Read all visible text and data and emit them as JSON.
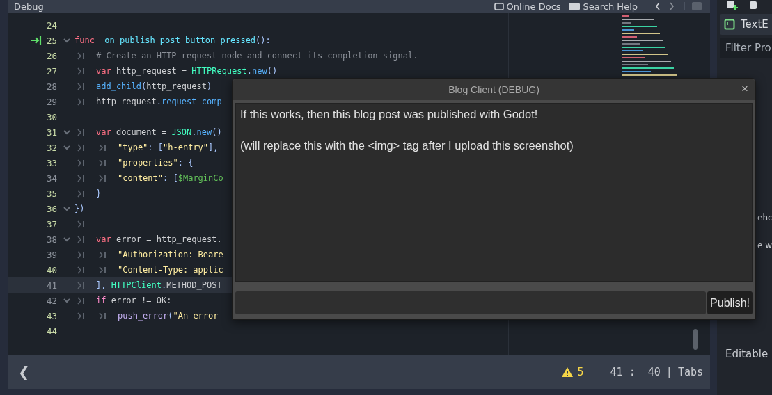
{
  "top_bar": {
    "menu_item": "Debug",
    "links": [
      {
        "kind": "docs",
        "label": "Online Docs"
      },
      {
        "kind": "help",
        "label": "Search Help"
      }
    ]
  },
  "editor": {
    "lines": [
      {
        "number": "24",
        "modified": true,
        "foldable": false,
        "executing": false,
        "current": false
      },
      {
        "number": "25",
        "modified": true,
        "foldable": true,
        "executing": true,
        "current": false,
        "tokens": [
          {
            "kind": "keyword",
            "text": "func"
          },
          {
            "kind": "funcname",
            "text": " _on_publish_post_button_pressed"
          },
          {
            "kind": "symbol",
            "text": "():"
          }
        ]
      },
      {
        "number": "26",
        "modified": true,
        "foldable": false,
        "executing": false,
        "current": false,
        "indent": [
          {
            "kind": "tab"
          }
        ],
        "tokens": [
          {
            "kind": "comment",
            "text": "# Create an HTTP request node and connect its completion signal."
          }
        ]
      },
      {
        "number": "27",
        "modified": true,
        "foldable": false,
        "executing": false,
        "current": false,
        "indent": [
          {
            "kind": "tab"
          }
        ],
        "tokens": [
          {
            "kind": "keyword",
            "text": "var"
          },
          {
            "kind": "plain",
            "text": " http_request = "
          },
          {
            "kind": "class",
            "text": "HTTPRequest"
          },
          {
            "kind": "symbol",
            "text": "."
          },
          {
            "kind": "method",
            "text": "new"
          },
          {
            "kind": "symbol",
            "text": "()"
          }
        ]
      },
      {
        "number": "28",
        "modified": false,
        "foldable": false,
        "executing": false,
        "current": false,
        "indent": [
          {
            "kind": "tab"
          }
        ],
        "tokens": [
          {
            "kind": "method",
            "text": "add_child"
          },
          {
            "kind": "symbol",
            "text": "("
          },
          {
            "kind": "plain",
            "text": "http_request"
          },
          {
            "kind": "symbol",
            "text": ")"
          }
        ]
      },
      {
        "number": "29",
        "modified": false,
        "foldable": false,
        "executing": false,
        "current": false,
        "indent": [
          {
            "kind": "tab"
          }
        ],
        "tokens": [
          {
            "kind": "plain",
            "text": "http_request"
          },
          {
            "kind": "symbol",
            "text": "."
          },
          {
            "kind": "method",
            "text": "request_comp"
          }
        ]
      },
      {
        "number": "30",
        "modified": true,
        "foldable": false,
        "executing": false,
        "current": false
      },
      {
        "number": "31",
        "modified": true,
        "foldable": true,
        "executing": false,
        "current": false,
        "indent": [
          {
            "kind": "tab"
          }
        ],
        "tokens": [
          {
            "kind": "keyword",
            "text": "var"
          },
          {
            "kind": "plain",
            "text": " document = "
          },
          {
            "kind": "class",
            "text": "JSON"
          },
          {
            "kind": "symbol",
            "text": "."
          },
          {
            "kind": "method",
            "text": "new"
          },
          {
            "kind": "symbol",
            "text": "()"
          }
        ]
      },
      {
        "number": "32",
        "modified": true,
        "foldable": true,
        "executing": false,
        "current": false,
        "indent": [
          {
            "kind": "tab"
          },
          {
            "kind": "tab"
          }
        ],
        "tokens": [
          {
            "kind": "string",
            "text": "\"type\""
          },
          {
            "kind": "symbol",
            "text": ": ["
          },
          {
            "kind": "string",
            "text": "\"h-entry\""
          },
          {
            "kind": "symbol",
            "text": "],"
          }
        ]
      },
      {
        "number": "33",
        "modified": true,
        "foldable": false,
        "executing": false,
        "current": false,
        "indent": [
          {
            "kind": "tab"
          },
          {
            "kind": "tab"
          }
        ],
        "tokens": [
          {
            "kind": "string",
            "text": "\"properties\""
          },
          {
            "kind": "symbol",
            "text": ": {"
          }
        ]
      },
      {
        "number": "34",
        "modified": false,
        "foldable": false,
        "executing": false,
        "current": false,
        "indent": [
          {
            "kind": "tab"
          },
          {
            "kind": "tab"
          }
        ],
        "tokens": [
          {
            "kind": "string",
            "text": "\"content\""
          },
          {
            "kind": "symbol",
            "text": ": ["
          },
          {
            "kind": "nodepath",
            "text": "$MarginCo"
          }
        ]
      },
      {
        "number": "35",
        "modified": true,
        "foldable": false,
        "executing": false,
        "current": false,
        "indent": [
          {
            "kind": "tab"
          }
        ],
        "tokens": [
          {
            "kind": "symbol",
            "text": "}"
          }
        ]
      },
      {
        "number": "36",
        "modified": true,
        "foldable": true,
        "executing": false,
        "current": false,
        "tokens": [
          {
            "kind": "symbol",
            "text": "})"
          }
        ]
      },
      {
        "number": "37",
        "modified": true,
        "foldable": false,
        "executing": false,
        "current": false,
        "indent": [
          {
            "kind": "tab"
          }
        ]
      },
      {
        "number": "38",
        "modified": false,
        "foldable": true,
        "executing": false,
        "current": false,
        "indent": [
          {
            "kind": "tab"
          }
        ],
        "tokens": [
          {
            "kind": "keyword",
            "text": "var"
          },
          {
            "kind": "plain",
            "text": " error = http_request."
          }
        ]
      },
      {
        "number": "39",
        "modified": false,
        "foldable": false,
        "executing": false,
        "current": false,
        "indent": [
          {
            "kind": "tab"
          },
          {
            "kind": "tab"
          }
        ],
        "tokens": [
          {
            "kind": "string",
            "text": "\"Authorization: Beare"
          }
        ]
      },
      {
        "number": "40",
        "modified": true,
        "foldable": false,
        "executing": false,
        "current": false,
        "indent": [
          {
            "kind": "tab"
          },
          {
            "kind": "tab"
          }
        ],
        "tokens": [
          {
            "kind": "string",
            "text": "\"Content-Type: applic"
          }
        ]
      },
      {
        "number": "41",
        "modified": false,
        "foldable": false,
        "executing": false,
        "current": true,
        "indent": [
          {
            "kind": "tab"
          }
        ],
        "tokens": [
          {
            "kind": "symbol",
            "text": "], "
          },
          {
            "kind": "class",
            "text": "HTTPClient"
          },
          {
            "kind": "symbol",
            "text": "."
          },
          {
            "kind": "plain",
            "text": "METHOD_POST"
          }
        ]
      },
      {
        "number": "42",
        "modified": false,
        "foldable": true,
        "executing": false,
        "current": false,
        "indent": [
          {
            "kind": "tab"
          }
        ],
        "tokens": [
          {
            "kind": "control",
            "text": "if"
          },
          {
            "kind": "plain",
            "text": " error != OK:"
          }
        ]
      },
      {
        "number": "43",
        "modified": true,
        "foldable": false,
        "executing": false,
        "current": false,
        "indent": [
          {
            "kind": "tab"
          },
          {
            "kind": "tab"
          }
        ],
        "tokens": [
          {
            "kind": "builtin",
            "text": "push_error"
          },
          {
            "kind": "symbol",
            "text": "("
          },
          {
            "kind": "string",
            "text": "\"An error"
          }
        ]
      },
      {
        "number": "44",
        "modified": true,
        "foldable": false,
        "executing": false,
        "current": false
      }
    ]
  },
  "status_bar": {
    "back": "❮",
    "warnings": "5",
    "position": "41 :  40",
    "separator": "|",
    "indentation": "Tabs"
  },
  "inspector": {
    "node_name": "TextE",
    "filter_placeholder": "Filter Pro",
    "fragments": [
      "ehc",
      "e w"
    ],
    "property": "Editable"
  },
  "dialog": {
    "title": "Blog Client (DEBUG)",
    "close": "×",
    "paragraphs": [
      "If this works, then this blog post was published with Godot!",
      "(will replace this with the <img> tag after I upload this screenshot)"
    ],
    "caret": true,
    "publish_button": "Publish!"
  }
}
